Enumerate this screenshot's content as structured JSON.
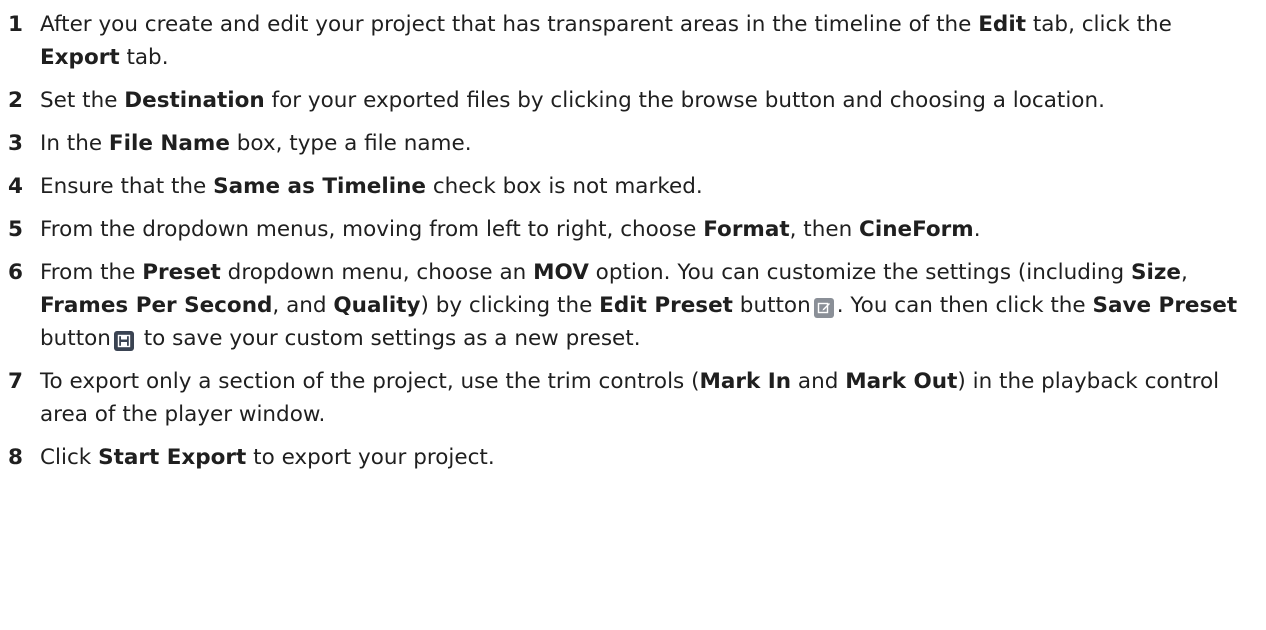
{
  "steps": [
    {
      "number": "1",
      "parts": [
        "After you create and edit your project that has transparent areas in the timeline of the ",
        "Edit",
        " tab, click the ",
        "Export",
        " tab."
      ]
    },
    {
      "number": "2",
      "parts": [
        "Set the ",
        "Destination",
        " for your exported files by clicking the browse button and choosing a location."
      ]
    },
    {
      "number": "3",
      "parts": [
        "In the ",
        "File Name",
        " box, type a file name."
      ]
    },
    {
      "number": "4",
      "parts": [
        "Ensure that the ",
        "Same as Timeline",
        " check box is not marked."
      ]
    },
    {
      "number": "5",
      "parts": [
        "From the dropdown menus, moving from left to right, choose ",
        "Format",
        ", then ",
        "CineForm",
        "."
      ]
    },
    {
      "number": "6",
      "parts": [
        "From the ",
        "Preset",
        " dropdown menu, choose an ",
        "MOV",
        " option. You can customize the settings (including ",
        "Size",
        ", ",
        "Frames Per Second",
        ", and ",
        "Quality",
        ") by clicking the ",
        "Edit Preset",
        " button",
        ". You can then click the ",
        "Save Preset",
        " button",
        " to save your custom settings as a new preset."
      ],
      "icons": {
        "edit_preset": "edit-icon",
        "save_preset": "save-icon"
      }
    },
    {
      "number": "7",
      "parts": [
        "To export only a section of the project, use the trim controls (",
        "Mark In",
        " and ",
        "Mark Out",
        ") in the playback control area of the player window."
      ]
    },
    {
      "number": "8",
      "parts": [
        "Click ",
        "Start Export",
        " to export your project."
      ]
    }
  ]
}
